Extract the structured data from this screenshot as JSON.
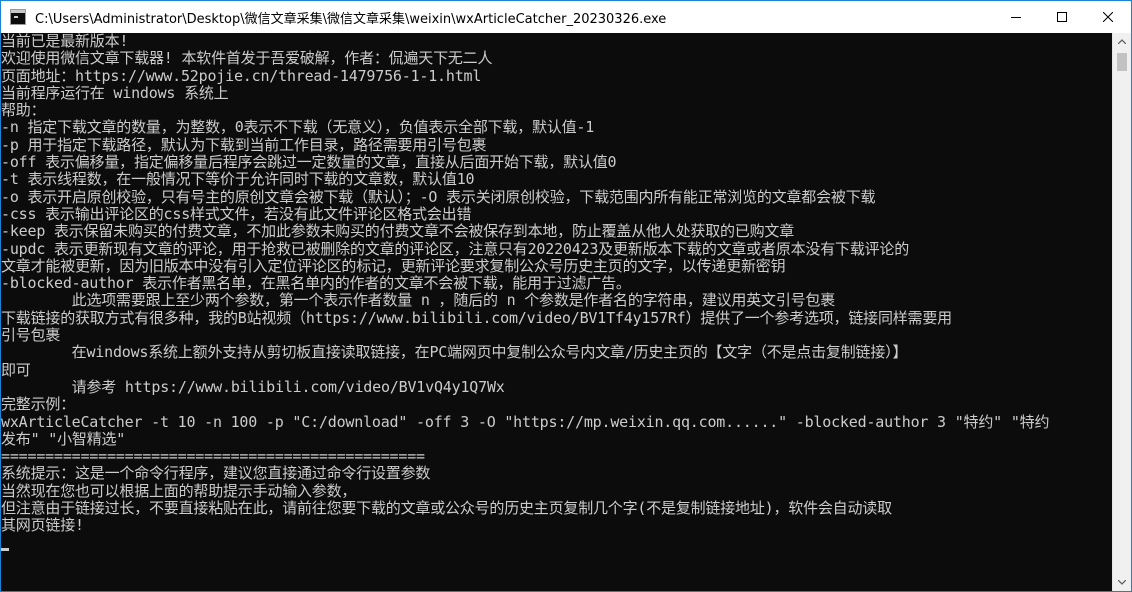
{
  "window": {
    "title": "C:\\Users\\Administrator\\Desktop\\微信文章采集\\微信文章采集\\weixin\\wxArticleCatcher_20230326.exe",
    "title_icon": "console-app-icon",
    "controls": [
      "minimize-icon",
      "maximize-icon",
      "close-icon"
    ]
  },
  "console": {
    "lines": [
      "当前已是最新版本!",
      "欢迎使用微信文章下载器! 本软件首发于吾爱破解，作者：侃遍天下无二人",
      "页面地址：https://www.52pojie.cn/thread-1479756-1-1.html",
      "当前程序运行在 windows 系统上",
      "帮助：",
      "-n 指定下载文章的数量，为整数，0表示不下载（无意义），负值表示全部下载，默认值-1",
      "-p 用于指定下载路径，默认为下载到当前工作目录，路径需要用引号包裹",
      "-off 表示偏移量，指定偏移量后程序会跳过一定数量的文章，直接从后面开始下载，默认值0",
      "-t 表示线程数，在一般情况下等价于允许同时下载的文章数，默认值10",
      "-o 表示开启原创校验，只有号主的原创文章会被下载（默认）；-O 表示关闭原创校验，下载范围内所有能正常浏览的文章都会被下载",
      "-css 表示输出评论区的css样式文件，若没有此文件评论区格式会出错",
      "-keep 表示保留未购买的付费文章，不加此参数未购买的付费文章不会被保存到本地，防止覆盖从他人处获取的已购文章",
      "-updc 表示更新现有文章的评论，用于抢救已被删除的文章的评论区，注意只有20220423及更新版本下载的文章或者原本没有下载评论的",
      "文章才能被更新，因为旧版本中没有引入定位评论区的标记，更新评论要求复制公众号历史主页的文字，以传递更新密钥",
      "-blocked-author 表示作者黑名单，在黑名单内的作者的文章不会被下载，能用于过滤广告。",
      "        此选项需要跟上至少两个参数，第一个表示作者数量 n ，随后的 n 个参数是作者名的字符串，建议用英文引号包裹",
      "下载链接的获取方式有很多种，我的B站视频（https://www.bilibili.com/video/BV1Tf4y157Rf）提供了一个参考选项，链接同样需要用",
      "引号包裹",
      "        在windows系统上额外支持从剪切板直接读取链接，在PC端网页中复制公众号内文章/历史主页的【文字（不是点击复制链接）】",
      "即可",
      "        请参考 https://www.bilibili.com/video/BV1vQ4y1Q7Wx",
      "完整示例：",
      "wxArticleCatcher -t 10 -n 100 -p \"C:/download\" -off 3 -O \"https://mp.weixin.qq.com......\" -blocked-author 3 \"特约\" \"特约",
      "发布\" \"小智精选\"",
      "================================================",
      "系统提示：这是一个命令行程序，建议您直接通过命令行设置参数",
      "当然现在您也可以根据上面的帮助提示手动输入参数，",
      "但注意由于链接过长，不要直接粘贴在此，请前往您要下载的文章或公众号的历史主页复制几个字(不是复制链接地址)，软件会自动读取",
      "其网页链接!"
    ]
  },
  "colors": {
    "console_bg": "#0c0c0c",
    "console_fg": "#cccccc",
    "titlebar_bg": "#ffffff",
    "window_border": "#1883d7"
  }
}
